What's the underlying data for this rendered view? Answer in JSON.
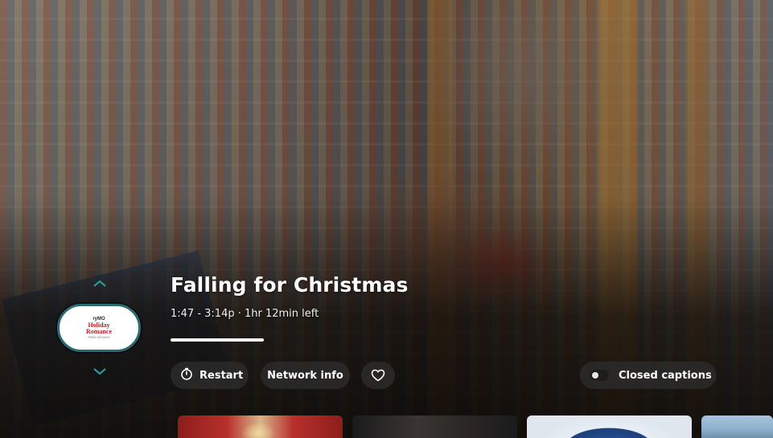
{
  "program": {
    "title": "Falling for Christmas",
    "time_range": "1:47 - 3:14p · 1hr 12min left",
    "progress_fraction": 0.29
  },
  "channel": {
    "logo_small_text": "ryMO",
    "logo_main_line1": "Holiday",
    "logo_main_line2": "Romance",
    "logo_sub_text": "FREE MOVIES"
  },
  "navigation": {
    "up_icon": "chevron-up-icon",
    "down_icon": "chevron-down-icon"
  },
  "actions": {
    "restart_label": "Restart",
    "restart_icon": "restart-icon",
    "network_info_label": "Network info",
    "favorite_icon": "heart-icon",
    "closed_captions_label": "Closed captions",
    "closed_captions_on": false
  },
  "colors": {
    "logo_ring": "#2d6b73",
    "logo_brand_red": "#b8222b",
    "button_bg": "#2d2d2d",
    "progress": "#ffffff"
  }
}
